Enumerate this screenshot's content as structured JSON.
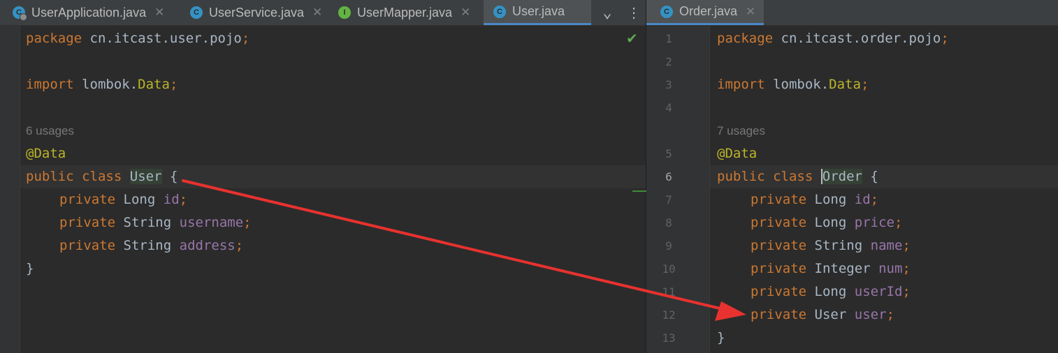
{
  "left_tabs": [
    {
      "label": "UserApplication.java",
      "icon": "spring-app-class-icon",
      "active": false
    },
    {
      "label": "UserService.java",
      "icon": "class-icon",
      "active": false
    },
    {
      "label": "UserMapper.java",
      "icon": "interface-icon",
      "active": false
    },
    {
      "label": "User.java",
      "icon": "class-icon",
      "active": true
    }
  ],
  "right_tabs": [
    {
      "label": "Order.java",
      "icon": "class-icon",
      "active": true
    }
  ],
  "tab_close": "✕",
  "tab_icon_letters": {
    "class": "C",
    "interface": "I"
  },
  "toolbar": {
    "dropdown": "⌄",
    "more": "⋮"
  },
  "left_editor": {
    "inspection_status": "✔",
    "usages": "6 usages",
    "code": {
      "package_kw": "package",
      "package_name": "cn.itcast.user.pojo",
      "import_kw": "import",
      "import_pkg": "lombok.",
      "import_class": "Data",
      "annotation": "@Data",
      "public_kw": "public",
      "class_kw": "class",
      "class_name": "User",
      "open_brace": "{",
      "close_brace": "}",
      "semicolon": ";",
      "fields": [
        {
          "modifier": "private",
          "type": "Long",
          "name": "id"
        },
        {
          "modifier": "private",
          "type": "String",
          "name": "username"
        },
        {
          "modifier": "private",
          "type": "String",
          "name": "address"
        }
      ]
    }
  },
  "right_editor": {
    "usages": "7 usages",
    "line_numbers": [
      "1",
      "2",
      "3",
      "4",
      "5",
      "6",
      "7",
      "8",
      "9",
      "10",
      "11",
      "12",
      "13"
    ],
    "current_line": "6",
    "code": {
      "package_kw": "package",
      "package_name": "cn.itcast.order.pojo",
      "import_kw": "import",
      "import_pkg": "lombok.",
      "import_class": "Data",
      "annotation": "@Data",
      "public_kw": "public",
      "class_kw": "class",
      "class_name": "Order",
      "open_brace": "{",
      "close_brace": "}",
      "semicolon": ";",
      "fields": [
        {
          "modifier": "private",
          "type": "Long",
          "name": "id"
        },
        {
          "modifier": "private",
          "type": "Long",
          "name": "price"
        },
        {
          "modifier": "private",
          "type": "String",
          "name": "name"
        },
        {
          "modifier": "private",
          "type": "Integer",
          "name": "num"
        },
        {
          "modifier": "private",
          "type": "Long",
          "name": "userId"
        },
        {
          "modifier": "private",
          "type": "User",
          "name": "user"
        }
      ]
    }
  },
  "colors": {
    "keyword": "#cc7832",
    "annotation": "#bbb529",
    "field": "#9876aa",
    "text": "#a9b7c6",
    "arrow": "#e8322f",
    "active_tab_underline": "#4a88c7"
  }
}
